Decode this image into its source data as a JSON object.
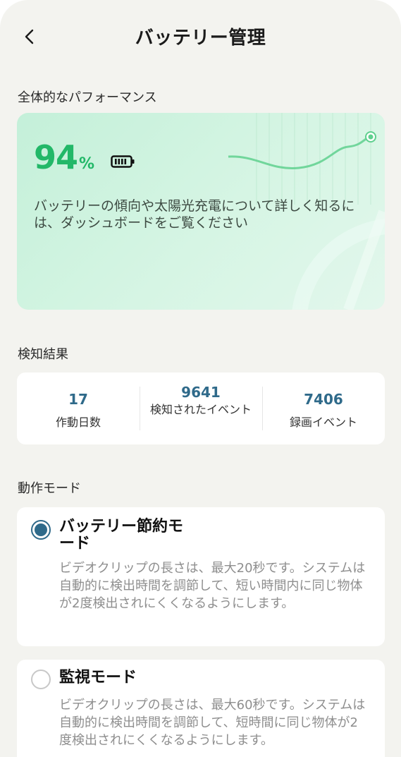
{
  "header": {
    "title": "バッテリー管理",
    "back_icon": "chevron-left-icon"
  },
  "performance": {
    "section_label": "全体的なパフォーマンス",
    "percent_value": "94",
    "percent_unit": "%",
    "battery_level_percent": 94,
    "battery_icon": "battery-icon",
    "description": "バッテリーの傾向や太陽光充電について詳しく知るには、ダッシュボードをご覧ください",
    "accent_color": "#22b868"
  },
  "detection": {
    "section_label": "検知結果",
    "stats": [
      {
        "value": "17",
        "label": "作動日数"
      },
      {
        "value": "9641",
        "label": "検知されたイベント"
      },
      {
        "value": "7406",
        "label": "録画イベント"
      }
    ],
    "value_color": "#2f6a8a"
  },
  "modes": {
    "section_label": "動作モード",
    "items": [
      {
        "title": "バッテリー節約モード",
        "selected": true,
        "description": "ビデオクリップの長さは、最大20秒です。システムは自動的に検出時間を調節して、短い時間内に同じ物体が2度検出されにくくなるようにします。"
      },
      {
        "title": "監視モード",
        "selected": false,
        "description": "ビデオクリップの長さは、最大60秒です。システムは自動的に検出時間を調節して、短時間に同じ物体が2度検出されにくくなるようにします。"
      }
    ]
  }
}
